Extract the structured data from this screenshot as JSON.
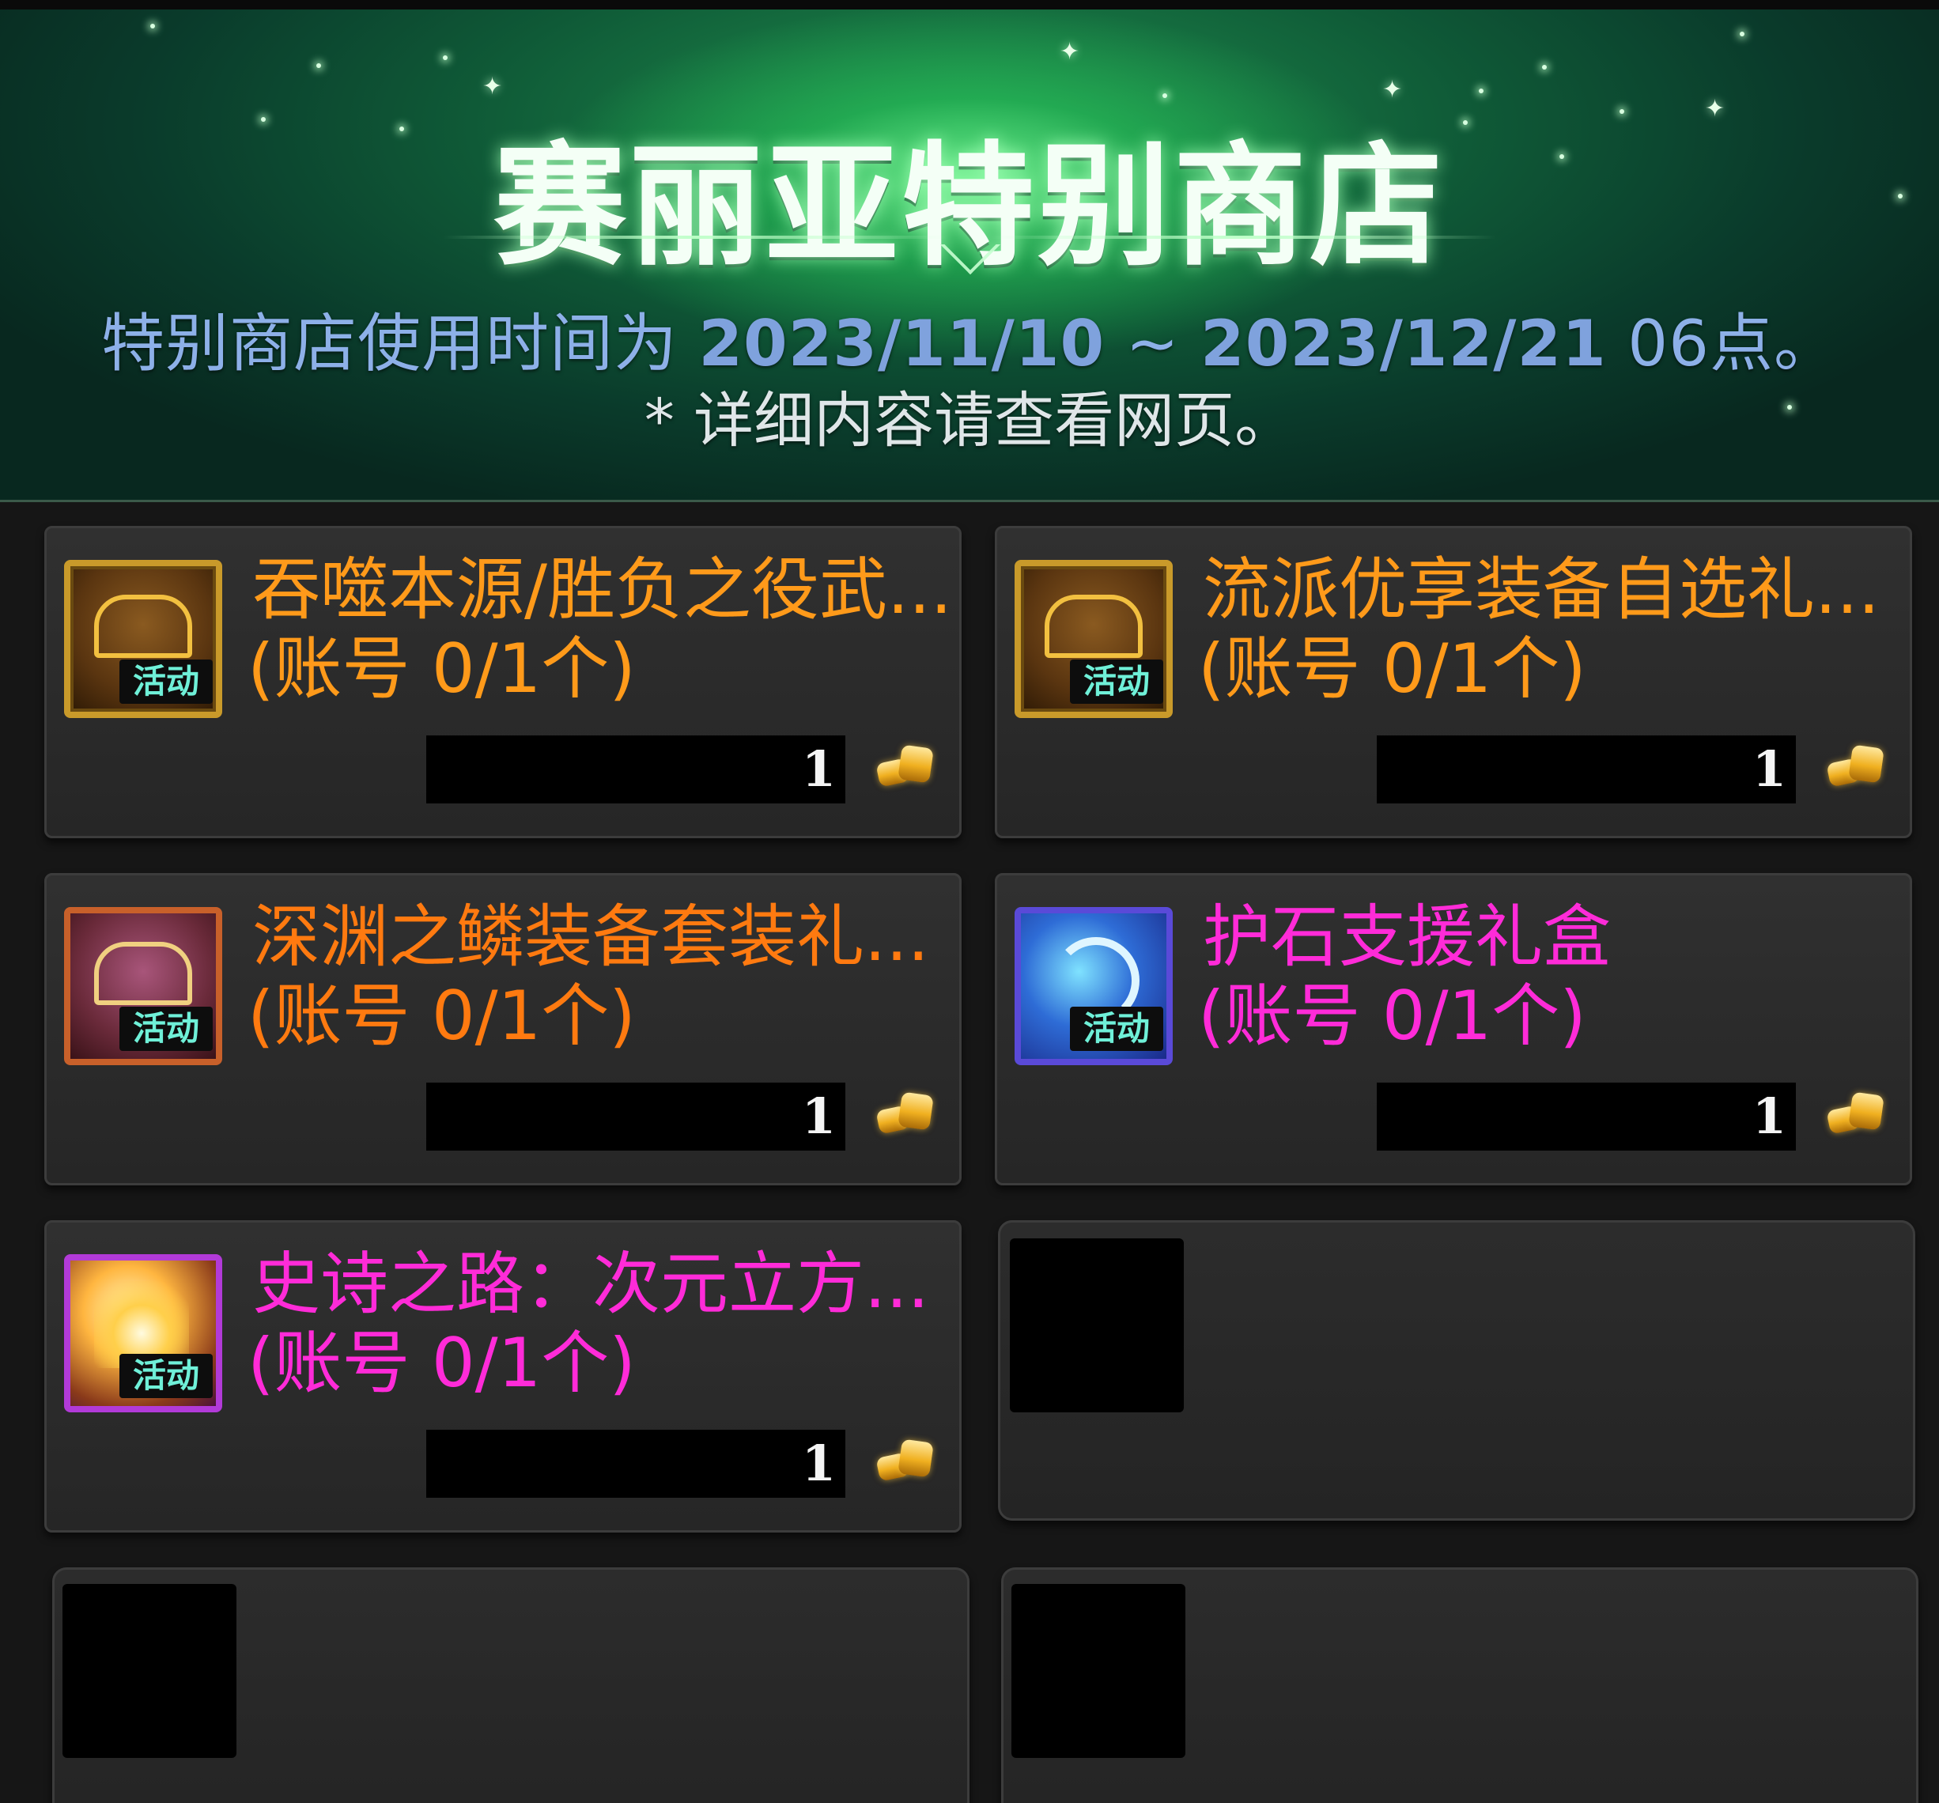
{
  "header": {
    "title": "赛丽亚特别商店",
    "period_prefix": "特别商店使用时间为",
    "period_start": "2023/11/10",
    "period_sep": "~",
    "period_end": "2023/12/21",
    "period_suffix": "06点。",
    "note": "* 详细内容请查看网页。"
  },
  "colors": {
    "orange_item": "#ff9a1a",
    "pink_item": "#ff2bd8",
    "subtitle_blue": "#8db0e8"
  },
  "items": [
    {
      "name": "吞噬本源/胜负之役武...",
      "limit": "(账号 0/1个)",
      "quantity": "1",
      "icon": "gold-treasure-chest-icon",
      "rarity_color": "#ff9a1a"
    },
    {
      "name": "流派优享装备自选礼...",
      "limit": "(账号 0/1个)",
      "quantity": "1",
      "icon": "gold-treasure-chest-icon",
      "rarity_color": "#ff9a1a"
    },
    {
      "name": "深渊之鳞装备套装礼...",
      "limit": "(账号 0/1个)",
      "quantity": "1",
      "icon": "abyss-equipment-box-icon",
      "rarity_color": "#ff7a10"
    },
    {
      "name": "护石支援礼盒",
      "limit": "(账号 0/1个)",
      "quantity": "1",
      "icon": "blue-talisman-box-icon",
      "rarity_color": "#ff2bd8"
    },
    {
      "name": "史诗之路：次元立方...",
      "limit": "(账号 0/1个)",
      "quantity": "1",
      "icon": "epic-dimension-cube-icon",
      "rarity_color": "#ff2bd8"
    }
  ],
  "icon_badge": "活动",
  "currency_icon": "gold-coin-icon"
}
